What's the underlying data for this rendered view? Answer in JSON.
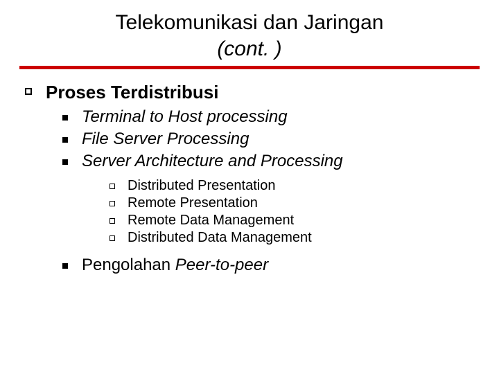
{
  "title_line1": "Telekomunikasi dan Jaringan",
  "title_line2": "(cont. )",
  "lvl1": {
    "text": "Proses Terdistribusi"
  },
  "lvl2": [
    {
      "text": "Terminal to Host processing"
    },
    {
      "text": "File Server Processing"
    },
    {
      "text": "Server Architecture and Processing"
    },
    {
      "text_pre": "Pengolahan ",
      "text_em": "Peer-to-peer"
    }
  ],
  "lvl3": [
    {
      "text": "Distributed Presentation"
    },
    {
      "text": "Remote Presentation"
    },
    {
      "text": "Remote Data Management"
    },
    {
      "text": "Distributed Data Management"
    }
  ]
}
